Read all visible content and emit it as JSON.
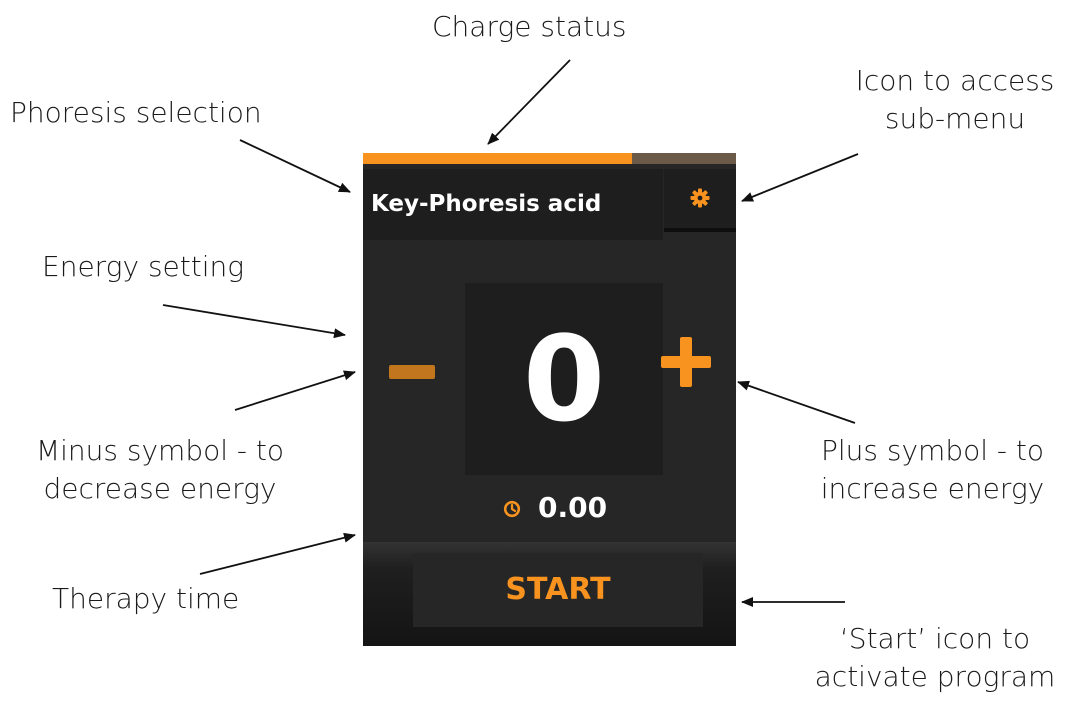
{
  "annotations": {
    "charge_status": "Charge status",
    "phoresis_selection": "Phoresis selection",
    "submenu_line1": "Icon to access",
    "submenu_line2": "sub-menu",
    "energy_setting": "Energy setting",
    "minus_line1": "Minus symbol - to",
    "minus_line2": "decrease energy",
    "plus_line1": "Plus symbol - to",
    "plus_line2": "increase energy",
    "therapy_time": "Therapy time",
    "start_line1": "‘Start’ icon to",
    "start_line2": "activate program"
  },
  "device": {
    "charge_level": 0.72,
    "phoresis_label": "Key-Phoresis acid",
    "energy_value": "0",
    "therapy_time": "0.00",
    "start_label": "START",
    "icons": {
      "submenu": "gear-icon",
      "minus": "minus-icon",
      "plus": "plus-icon",
      "timer": "clock-icon"
    }
  },
  "colors": {
    "accent": "#f7931e",
    "panel": "#262626",
    "panel_dark": "#1e1e1e",
    "charge_track": "#6b5a48",
    "text_on_panel": "#ffffff"
  }
}
